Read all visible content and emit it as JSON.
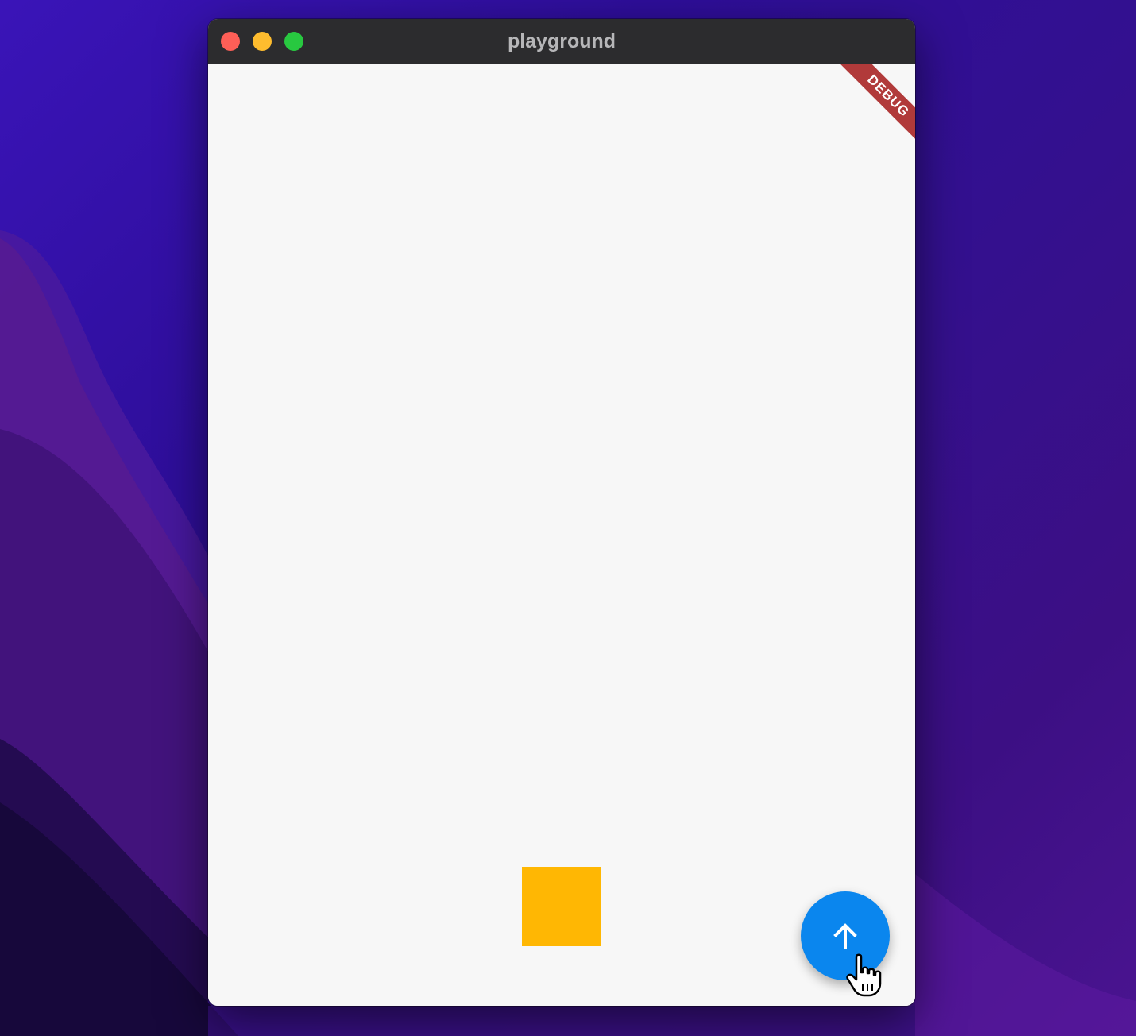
{
  "window": {
    "title": "playground",
    "controls": {
      "close_color": "#fe5f57",
      "minimize_color": "#febc2e",
      "zoom_color": "#28c840"
    }
  },
  "app": {
    "debug_banner_label": "DEBUG",
    "debug_banner_color": "#b13a3a",
    "square_color": "#ffb703",
    "fab": {
      "icon": "arrow-up-icon",
      "color": "#0a86ee"
    }
  },
  "cursor": {
    "icon": "hand-pointer-icon"
  }
}
